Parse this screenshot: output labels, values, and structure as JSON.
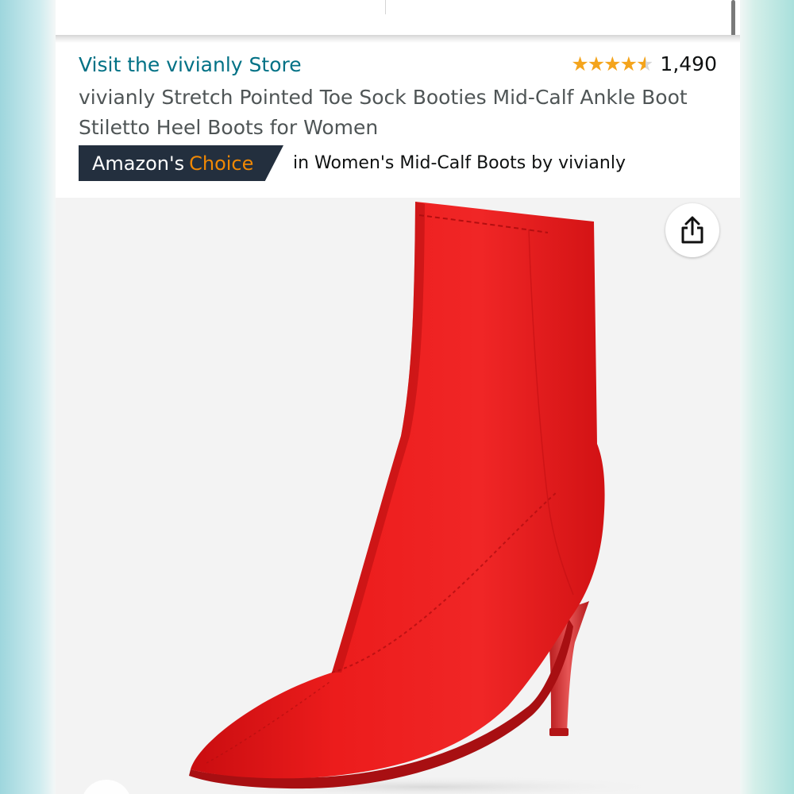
{
  "store": {
    "link_label": "Visit the vivianly Store"
  },
  "rating": {
    "stars": 4.5,
    "count": "1,490",
    "star_color": "#f4a41c"
  },
  "product": {
    "title": "vivianly Stretch Pointed Toe Sock Booties Mid-Calf Ankle Boot Stiletto Heel Boots for Women"
  },
  "badge": {
    "prefix": "Amazon's",
    "highlight": "Choice",
    "context": "in Women's Mid-Calf Boots by vivianly",
    "highlight_color": "#f08804",
    "background_color": "#232f3e"
  },
  "image": {
    "subject": "red stretch sock bootie with stiletto heel",
    "boot_color": "#e8191a"
  },
  "icons": {
    "share": "share-icon"
  },
  "colors": {
    "link": "#007185",
    "title_text": "#4f5556"
  }
}
